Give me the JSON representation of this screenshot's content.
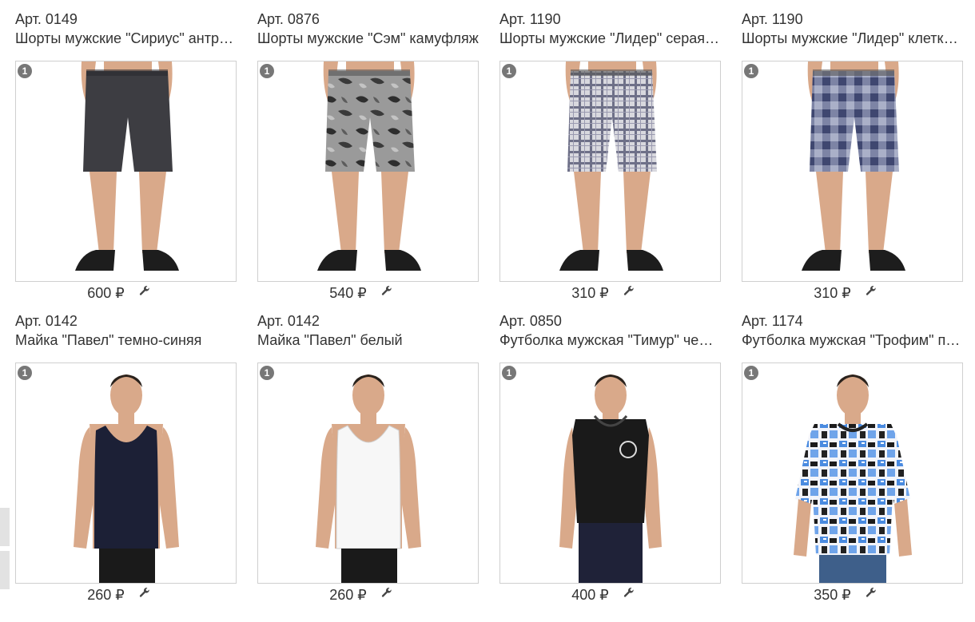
{
  "products": [
    {
      "article": "Арт. 0149",
      "name": "Шорты мужские \"Сириус\" антрацит",
      "price": "600 ₽",
      "badge": "1",
      "kind": "shorts",
      "color": "#3d3d42",
      "pattern": "solid"
    },
    {
      "article": "Арт. 0876",
      "name": "Шорты мужские \"Сэм\" камуфляж",
      "price": "540 ₽",
      "badge": "1",
      "kind": "shorts",
      "color": "#8a8a8a",
      "pattern": "camo"
    },
    {
      "article": "Арт. 1190",
      "name": "Шорты мужские \"Лидер\" серая клетка",
      "price": "310 ₽",
      "badge": "1",
      "kind": "shorts",
      "color": "#b9b9c2",
      "pattern": "plaid"
    },
    {
      "article": "Арт. 1190",
      "name": "Шорты мужские \"Лидер\" клетка синяя",
      "price": "310 ₽",
      "badge": "1",
      "kind": "shorts",
      "color": "#4a5478",
      "pattern": "check"
    },
    {
      "article": "Арт. 0142",
      "name": "Майка \"Павел\" темно-синяя",
      "price": "260 ₽",
      "badge": "1",
      "kind": "tank",
      "color": "#1c2036",
      "pattern": "solid"
    },
    {
      "article": "Арт. 0142",
      "name": "Майка \"Павел\" белый",
      "price": "260 ₽",
      "badge": "1",
      "kind": "tank",
      "color": "#f7f7f7",
      "pattern": "solid"
    },
    {
      "article": "Арт. 0850",
      "name": "Футболка мужская \"Тимур\" черная",
      "price": "400 ₽",
      "badge": "1",
      "kind": "hoodie",
      "color": "#1a1a1a",
      "pattern": "solid"
    },
    {
      "article": "Арт. 1174",
      "name": "Футболка мужская \"Трофим\" принт",
      "price": "350 ₽",
      "badge": "1",
      "kind": "tee",
      "color": "#5b8fd6",
      "pattern": "print"
    }
  ],
  "icons": {
    "edit": "wrench-icon"
  }
}
